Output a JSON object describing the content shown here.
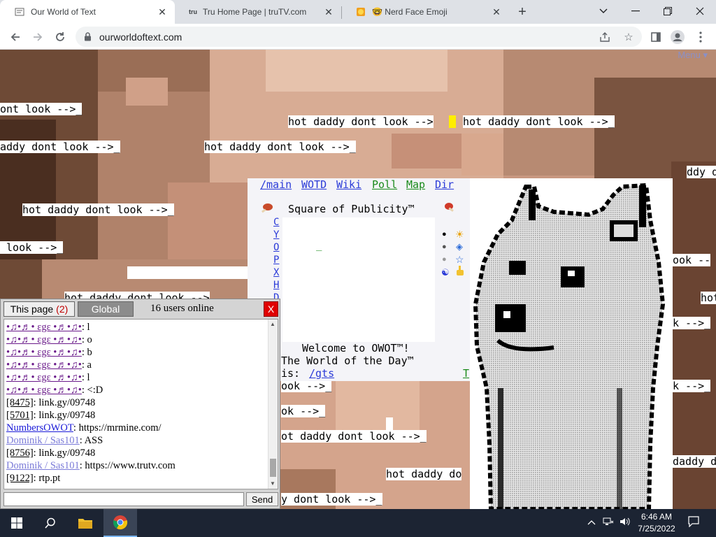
{
  "browser": {
    "tabs": [
      {
        "title": "Our World of Text",
        "active": true,
        "icon": "owot-favicon"
      },
      {
        "title": "Tru Home Page | truTV.com",
        "active": false,
        "icon": "trutv-favicon",
        "icon_text": "tru"
      },
      {
        "title": "🤓 Nerd Face Emoji",
        "active": false,
        "icon": "emoji-favicon"
      }
    ],
    "url": "ourworldoftext.com"
  },
  "page": {
    "menu_label": "Menu ▾",
    "background_text": [
      "ont look -->_",
      "hot daddy dont look -->",
      "_",
      "hot daddy dont look -->_",
      "addy dont look -->_",
      "hot daddy dont look -->_",
      "hot daddy dont look -->_",
      " look -->_",
      "hot daddy dont look -->",
      "ddy d",
      "ook --",
      "hot",
      "k -->_",
      "k -->_",
      "daddy d",
      "ook -->_",
      "ok -->_",
      "ot daddy dont look -->_",
      "hot daddy do",
      "y dont look -->_",
      "_"
    ],
    "nav_links": [
      "/main",
      "WOTD",
      "Wiki",
      "Poll",
      "Map",
      "Dir"
    ],
    "square_title": "Square of Publicity™",
    "side_letters": [
      "C",
      "Y",
      "O",
      "P",
      "X",
      "H",
      "D"
    ],
    "welcome_lines": [
      "Welcome to OWOT™!",
      "The World of the Day™",
      "is: "
    ],
    "wotd_link": "/gts",
    "t_link": "T",
    "underscore": "_"
  },
  "chat": {
    "tab_this_page": "This page",
    "this_page_count": "(2)",
    "tab_global": "Global",
    "users_online": "16 users online",
    "close_label": "X",
    "send_label": "Send",
    "input_value": "",
    "messages": [
      {
        "nick": "•♫•♬• εgε •♬•♫•",
        "text": " l",
        "deco": true
      },
      {
        "nick": "•♫•♬• εgε •♬•♫•",
        "text": " o",
        "deco": true
      },
      {
        "nick": "•♫•♬• εgε •♬•♫•",
        "text": " b",
        "deco": true
      },
      {
        "nick": "•♫•♬• εgε •♬•♫•",
        "text": " a",
        "deco": true
      },
      {
        "nick": "•♫•♬• εgε •♬•♫•",
        "text": " l",
        "deco": true
      },
      {
        "nick": "•♫•♬• εgε •♬•♫•",
        "text": " <:D",
        "deco": true
      },
      {
        "nick": "[8475]",
        "text": " link.gy/09748",
        "color": "#000000"
      },
      {
        "nick": "[5701]",
        "text": " link.gy/09748",
        "color": "#000000"
      },
      {
        "nick": "NumbersOWOT",
        "text": " https://mrmine.com/",
        "color": "#1a1ad8"
      },
      {
        "nick": "Dominik / Sas101",
        "text": " ASS",
        "color": "#7a7ad8"
      },
      {
        "nick": "[8756]",
        "text": " link.gy/09748",
        "color": "#000000"
      },
      {
        "nick": "Dominik / Sas101",
        "text": " https://www.trutv.com",
        "color": "#7a7ad8"
      },
      {
        "nick": "[9122]",
        "text": " rtp.pt",
        "color": "#000000"
      }
    ]
  },
  "taskbar": {
    "time": "6:46 AM",
    "date": "7/25/2022"
  },
  "colors": {
    "cursor": "#ffee00",
    "chat_close": "#e00000",
    "link_blue": "#2b3bd8",
    "link_green": "#1a8a1a"
  }
}
